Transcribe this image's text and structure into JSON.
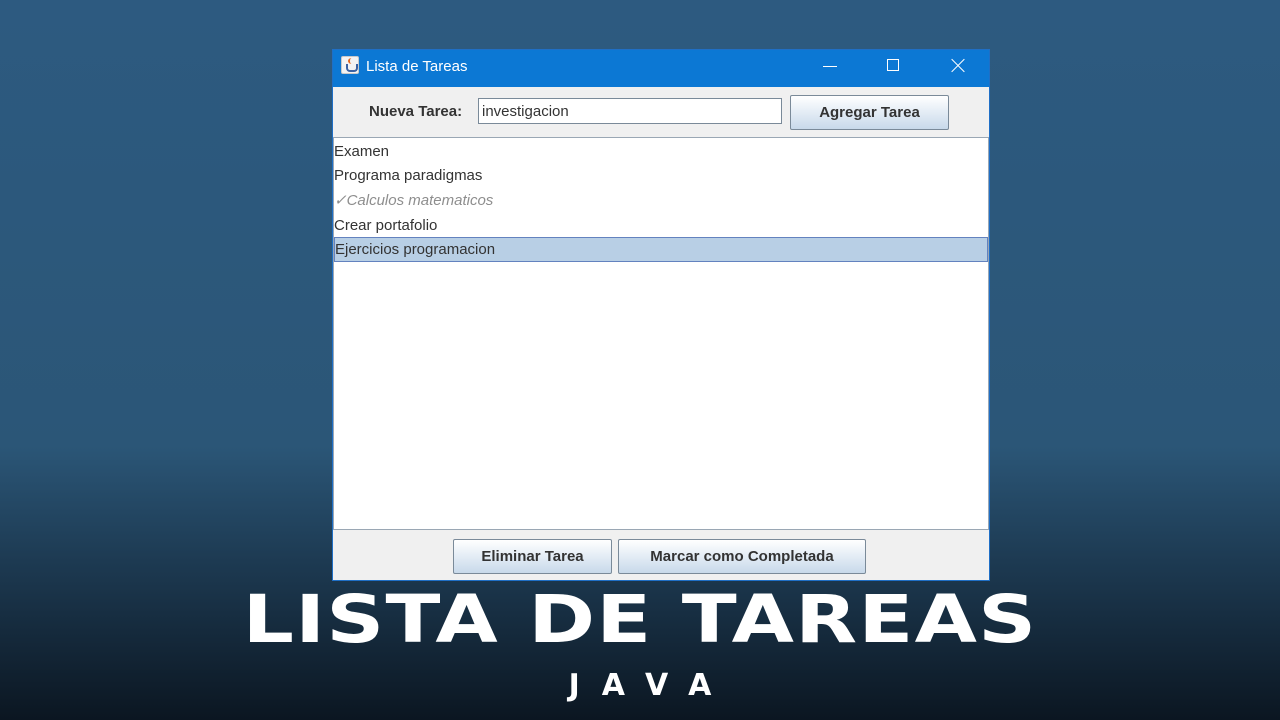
{
  "window": {
    "title": "Lista de Tareas",
    "icon": "java-cup-icon",
    "controls": [
      "minimize-icon",
      "maximize-icon",
      "close-icon"
    ]
  },
  "form": {
    "label": "Nueva Tarea:",
    "input_value": "investigacion",
    "add_button": "Agregar Tarea"
  },
  "tasks": [
    {
      "text": "Examen",
      "completed": false,
      "selected": false
    },
    {
      "text": "Programa paradigmas",
      "completed": false,
      "selected": false
    },
    {
      "text": "✓Calculos matematicos",
      "completed": true,
      "selected": false
    },
    {
      "text": "Crear portafolio",
      "completed": false,
      "selected": false
    },
    {
      "text": "Ejercicios programacion",
      "completed": false,
      "selected": true
    }
  ],
  "actions": {
    "delete_button": "Eliminar Tarea",
    "complete_button": "Marcar como Completada"
  },
  "banner": {
    "title": "LISTA DE TAREAS",
    "subtitle": "JAVA"
  },
  "colors": {
    "titlebar": "#0c78d4",
    "selection": "#b8cfe5",
    "completed_text": "#8e8e8e"
  }
}
